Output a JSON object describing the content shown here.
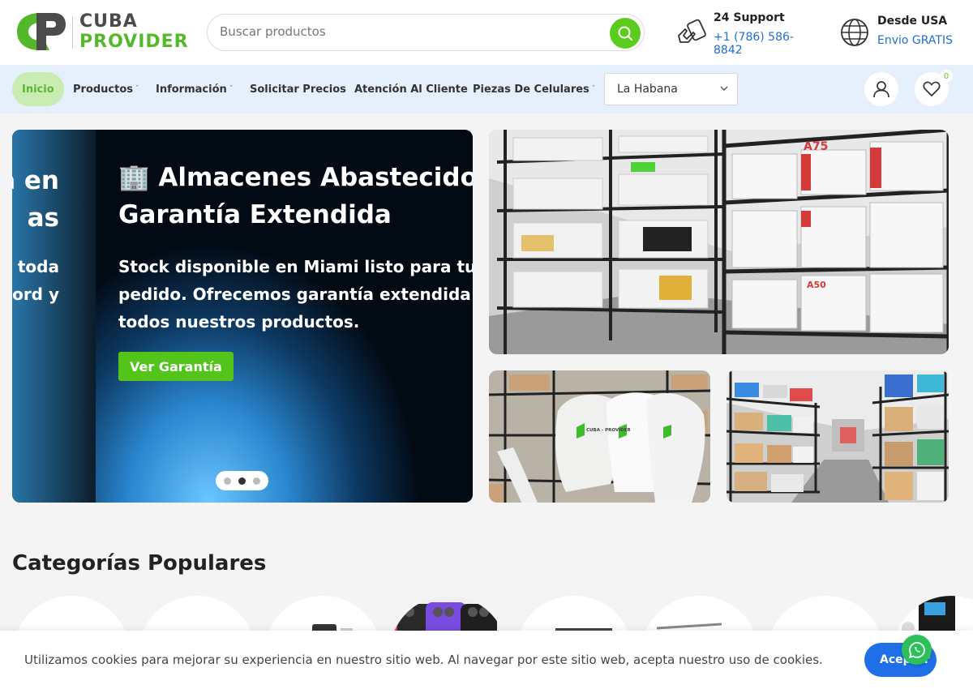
{
  "brand": {
    "line1": "CUBA",
    "line2": "PROVIDER",
    "primary_color": "#5bcc1e",
    "text_color": "#4b4b4b"
  },
  "search": {
    "placeholder": "Buscar productos"
  },
  "support": {
    "title": "24 Support",
    "phone": "+1 (786) 586-8842"
  },
  "shipping": {
    "title": "Desde USA",
    "subtitle": "Envio GRATIS"
  },
  "nav": {
    "items": [
      {
        "label": "Inicio",
        "active": true,
        "dropdown": false
      },
      {
        "label": "Productos",
        "active": false,
        "dropdown": true
      },
      {
        "label": "Información",
        "active": false,
        "dropdown": true
      },
      {
        "label": "Solicitar Precios",
        "active": false,
        "dropdown": false
      },
      {
        "label": "Atención Al Cliente",
        "active": false,
        "dropdown": false
      },
      {
        "label": "Piezas De Celulares",
        "active": false,
        "dropdown": true
      }
    ],
    "caret": "˅",
    "city_selected": "La Habana",
    "wishlist_count": "0"
  },
  "hero": {
    "prev_slide": {
      "title_line1": "a en",
      "title_line2": "as",
      "text_line1": "n toda",
      "text_line2": "ecord y"
    },
    "current_slide": {
      "emoji": "🏢",
      "title_line1": "Almacenes Abastecidos",
      "title_line2": "Garantía Extendida",
      "text": "Stock disponible en Miami listo para tu pedido. Ofrecemos garantía extendida en todos nuestros productos.",
      "cta": "Ver Garantía"
    },
    "dots": {
      "count": 3,
      "active_index": 1
    }
  },
  "gallery": [
    {
      "name": "warehouse-shelves-phone-boxes"
    },
    {
      "name": "warehouse-shipping-bags"
    },
    {
      "name": "warehouse-inventory-aisle"
    }
  ],
  "gallery_labels": {
    "bag_print": "CUBA - PROVIDER",
    "box_label": "A75",
    "box_label_2": "A50"
  },
  "categories": {
    "title": "Categorías Populares",
    "count_visible": 8
  },
  "cookie": {
    "text": "Utilizamos cookies para mejorar su experiencia en nuestro sitio web. Al navegar por este sitio web, acepta nuestro uso de cookies.",
    "accept": "Aceptar"
  },
  "colors": {
    "nav_bg": "#e6effc",
    "link_blue": "#1f6fd0",
    "accept_blue": "#1f6fe8",
    "whatsapp_green": "#2bc05a"
  }
}
